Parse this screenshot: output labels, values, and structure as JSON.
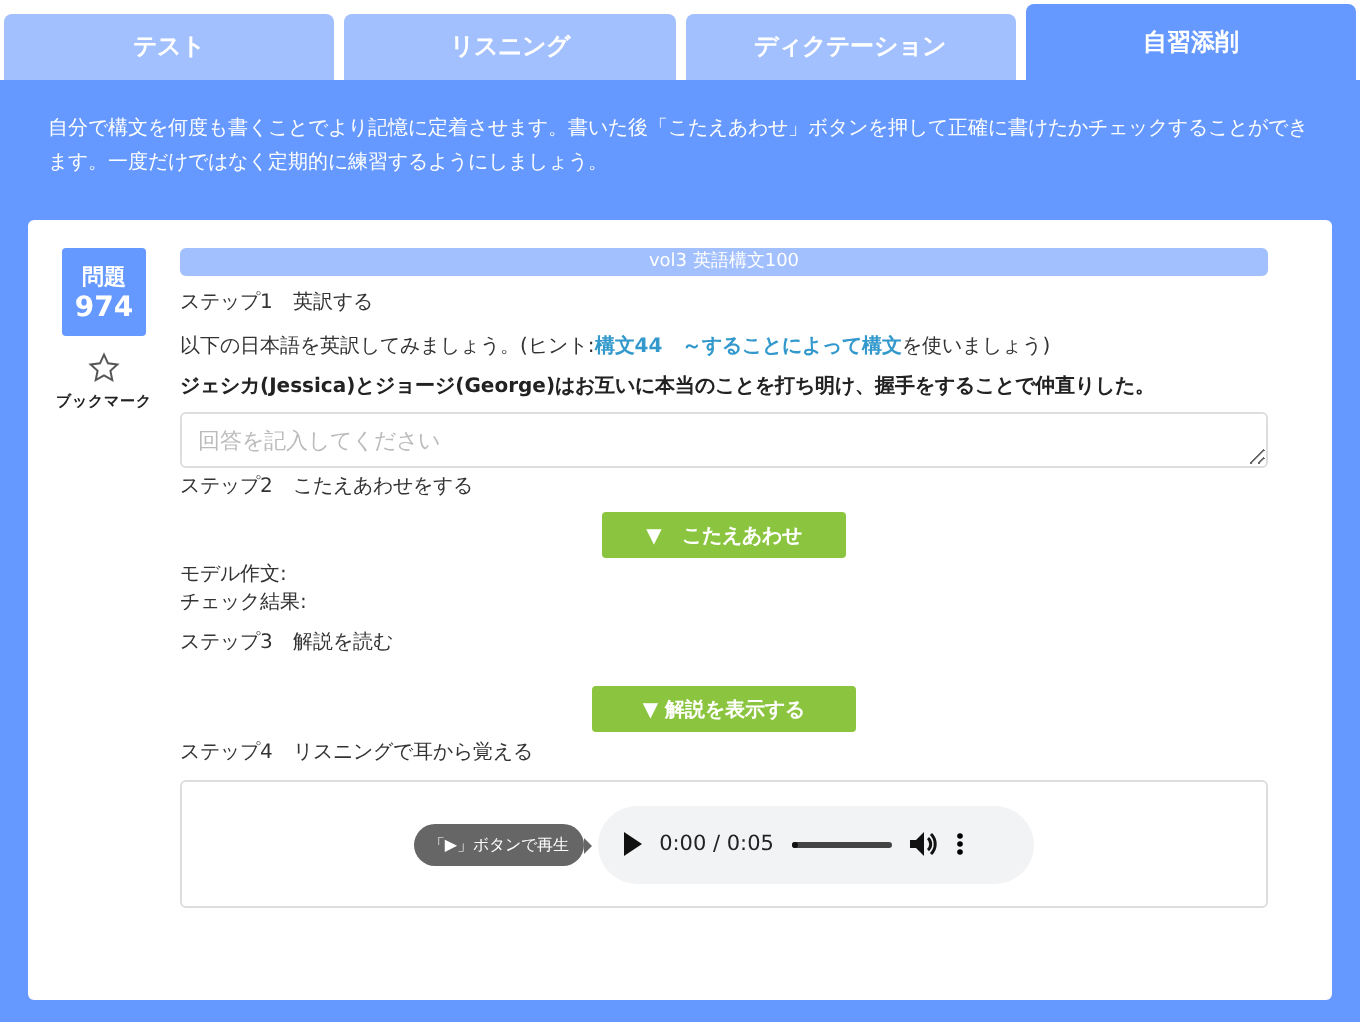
{
  "tabs": [
    {
      "label": "テスト",
      "selected": false
    },
    {
      "label": "リスニング",
      "selected": false
    },
    {
      "label": "ディクテーション",
      "selected": false
    },
    {
      "label": "自習添削",
      "selected": true
    }
  ],
  "intro": "自分で構文を何度も書くことでより記憶に定着させます。書いた後「こたえあわせ」ボタンを押して正確に書けたかチェックすることができます。一度だけではなく定期的に練習するようにしましょう。",
  "question": {
    "label": "問題",
    "number": "974",
    "bookmark": "ブックマーク",
    "bookmarked": false
  },
  "book": "vol3 英語構文100",
  "step1": {
    "title": "ステップ1　英訳する",
    "hint_before": "以下の日本語を英訳してみましょう。(ヒント:",
    "hint_link": "構文44　～することによって構文",
    "hint_after": "を使いましょう)",
    "sentence": "ジェシカ(Jessica)とジョージ(George)はお互いに本当のことを打ち明け、握手をすることで仲直りした。",
    "answer_placeholder": "回答を記入してください"
  },
  "step2": {
    "title": "ステップ2　こたえあわせをする",
    "button": "▼　こたえあわせ",
    "model_label": "モデル作文:",
    "check_label": "チェック結果:"
  },
  "step3": {
    "title": "ステップ3　解説を読む",
    "button": "▼ 解説を表示する"
  },
  "step4": {
    "title": "ステップ4　リスニングで耳から覚える",
    "tooltip": "「▶」ボタンで再生",
    "time": "0:00 / 0:05",
    "level": 0
  }
}
